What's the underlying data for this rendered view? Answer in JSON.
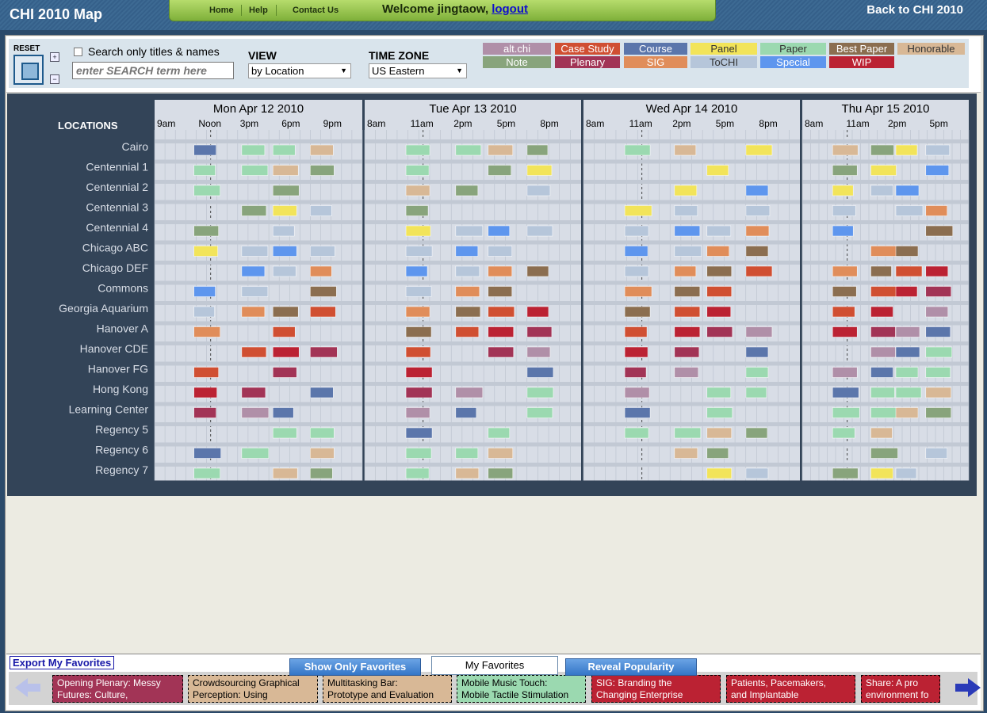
{
  "header": {
    "app_title": "CHI 2010 Map",
    "back_link": "Back to CHI 2010",
    "nav": [
      {
        "label": "Home"
      },
      {
        "label": "Help"
      },
      {
        "label": "Contact Us"
      }
    ],
    "welcome_text": "Welcome jingtaow,",
    "logout_label": "logout"
  },
  "controls": {
    "reset_label": "RESET",
    "zoom_in": "+",
    "zoom_out": "−",
    "search_only_label": "Search only titles & names",
    "search_only_checked": false,
    "search_placeholder": "enter SEARCH term here",
    "view_label": "VIEW",
    "view_value": "by Location",
    "timezone_label": "TIME ZONE",
    "timezone_value": "US Eastern"
  },
  "legend": [
    {
      "label": "alt.chi",
      "color": "#b08fa8"
    },
    {
      "label": "Case Study",
      "color": "#d04f32"
    },
    {
      "label": "Course",
      "color": "#5b76ab"
    },
    {
      "label": "Panel",
      "color": "#f2e45a",
      "text_color": "#333333"
    },
    {
      "label": "Paper",
      "color": "#9bd9b0",
      "text_color": "#333333"
    },
    {
      "label": "Best Paper",
      "color": "#8b6e50"
    },
    {
      "label": "Honorable",
      "color": "#d8b896",
      "text_color": "#333333"
    },
    {
      "label": "Note",
      "color": "#88a47c"
    },
    {
      "label": "Plenary",
      "color": "#a23456"
    },
    {
      "label": "SIG",
      "color": "#e08d5a"
    },
    {
      "label": "ToCHI",
      "color": "#b6c6da",
      "text_color": "#333333"
    },
    {
      "label": "Special",
      "color": "#5e96ee"
    },
    {
      "label": "WIP",
      "color": "#bb2233"
    }
  ],
  "schedule": {
    "locations_header": "LOCATIONS",
    "days": [
      {
        "label": "Mon Apr 12 2010",
        "times": [
          "9am",
          "Noon",
          "3pm",
          "6pm",
          "9pm"
        ]
      },
      {
        "label": "Tue Apr 13 2010",
        "times": [
          "8am",
          "11am",
          "2pm",
          "5pm",
          "8pm"
        ]
      },
      {
        "label": "Wed Apr 14 2010",
        "times": [
          "8am",
          "11am",
          "2pm",
          "5pm",
          "8pm"
        ]
      },
      {
        "label": "Thu Apr 15 2010",
        "times": [
          "8am",
          "11am",
          "2pm",
          "5pm"
        ]
      }
    ],
    "locations": [
      "Cairo",
      "Centennial 1",
      "Centennial 2",
      "Centennial 3",
      "Centennial 4",
      "Chicago ABC",
      "Chicago DEF",
      "Commons",
      "Georgia Aquarium",
      "Hanover A",
      "Hanover CDE",
      "Hanover FG",
      "Hong Kong",
      "Learning Center",
      "Regency 5",
      "Regency 6",
      "Regency 7"
    ]
  },
  "bottom": {
    "export_label": "Export My Favorites",
    "show_only_favorites": "Show Only Favorites",
    "my_favorites_tab": "My Favorites",
    "reveal_popularity": "Reveal Popularity",
    "favorites": [
      {
        "line1": "Opening Plenary: Messy",
        "line2": "Futures: Culture,",
        "color": "#a23456",
        "text_color": "#ffffff"
      },
      {
        "line1": "Crowdsourcing Graphical",
        "line2": "Perception: Using",
        "color": "#d8b896",
        "text_color": "#000000"
      },
      {
        "line1": "Multitasking Bar:",
        "line2": "Prototype and Evaluation",
        "color": "#d8b896",
        "text_color": "#000000"
      },
      {
        "line1": "Mobile Music Touch:",
        "line2": "Mobile Tactile Stimulation",
        "color": "#9bd9b0",
        "text_color": "#000000"
      },
      {
        "line1": "SIG: Branding the",
        "line2": "Changing Enterprise",
        "color": "#bb2233",
        "text_color": "#ffffff"
      },
      {
        "line1": "Patients, Pacemakers,",
        "line2": "and Implantable",
        "color": "#bb2233",
        "text_color": "#ffffff"
      },
      {
        "line1": "Share: A pro",
        "line2": "environment fo",
        "color": "#bb2233",
        "text_color": "#ffffff"
      }
    ]
  }
}
